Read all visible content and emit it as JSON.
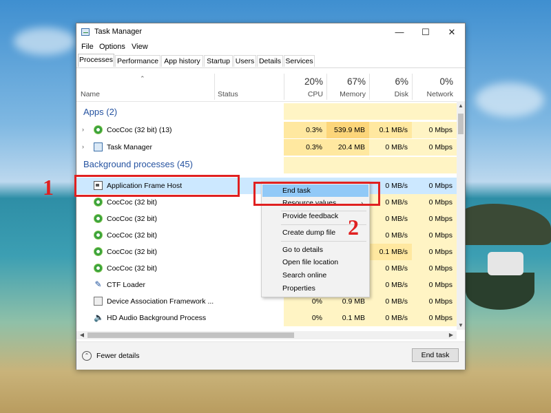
{
  "window": {
    "title": "Task Manager",
    "controls": {
      "minimize": "—",
      "maximize": "☐",
      "close": "✕"
    }
  },
  "menu": [
    "File",
    "Options",
    "View"
  ],
  "tabs": [
    "Processes",
    "Performance",
    "App history",
    "Startup",
    "Users",
    "Details",
    "Services"
  ],
  "columns": {
    "name": "Name",
    "status": "Status",
    "cpu": {
      "pct": "20%",
      "label": "CPU"
    },
    "memory": {
      "pct": "67%",
      "label": "Memory"
    },
    "disk": {
      "pct": "6%",
      "label": "Disk"
    },
    "network": {
      "pct": "0%",
      "label": "Network"
    }
  },
  "groups": {
    "apps": "Apps (2)",
    "background": "Background processes (45)"
  },
  "apps": [
    {
      "name": "CocCoc (32 bit) (13)",
      "icon": "coccoc-icon",
      "cpu": "0.3%",
      "memory": "539.9 MB",
      "disk": "0.1 MB/s",
      "network": "0 Mbps"
    },
    {
      "name": "Task Manager",
      "icon": "task-manager-icon",
      "cpu": "0.3%",
      "memory": "20.4 MB",
      "disk": "0 MB/s",
      "network": "0 Mbps"
    }
  ],
  "background": [
    {
      "name": "Application Frame Host",
      "icon": "app-frame-icon",
      "cpu": "",
      "memory": "",
      "disk": "0 MB/s",
      "network": "0 Mbps"
    },
    {
      "name": "CocCoc (32 bit)",
      "icon": "coccoc-icon",
      "cpu": "",
      "memory": "",
      "disk": "0 MB/s",
      "network": "0 Mbps"
    },
    {
      "name": "CocCoc (32 bit)",
      "icon": "coccoc-icon",
      "cpu": "",
      "memory": "",
      "disk": "0 MB/s",
      "network": "0 Mbps"
    },
    {
      "name": "CocCoc (32 bit)",
      "icon": "coccoc-icon",
      "cpu": "",
      "memory": "",
      "disk": "0 MB/s",
      "network": "0 Mbps"
    },
    {
      "name": "CocCoc (32 bit)",
      "icon": "coccoc-icon",
      "cpu": "",
      "memory": "",
      "disk": "0.1 MB/s",
      "network": "0 Mbps"
    },
    {
      "name": "CocCoc (32 bit)",
      "icon": "coccoc-icon",
      "cpu": "",
      "memory": "",
      "disk": "0 MB/s",
      "network": "0 Mbps"
    },
    {
      "name": "CTF Loader",
      "icon": "ctf-loader-icon",
      "cpu": "",
      "memory": "",
      "disk": "0 MB/s",
      "network": "0 Mbps"
    },
    {
      "name": "Device Association Framework ...",
      "icon": "device-icon",
      "cpu": "0%",
      "memory": "0.9 MB",
      "disk": "0 MB/s",
      "network": "0 Mbps"
    },
    {
      "name": "HD Audio Background Process",
      "icon": "audio-icon",
      "cpu": "0%",
      "memory": "0.1 MB",
      "disk": "0 MB/s",
      "network": "0 Mbps"
    }
  ],
  "context_menu": [
    {
      "label": "End task",
      "highlighted": true
    },
    {
      "label": "Resource values",
      "submenu": true
    },
    {
      "separator": true
    },
    {
      "label": "Provide feedback"
    },
    {
      "separator": true
    },
    {
      "label": "Create dump file"
    },
    {
      "separator": true
    },
    {
      "label": "Go to details"
    },
    {
      "label": "Open file location"
    },
    {
      "label": "Search online"
    },
    {
      "label": "Properties"
    }
  ],
  "footer": {
    "fewer_details": "Fewer details",
    "end_task": "End task"
  },
  "annotations": {
    "one": "1",
    "two": "2"
  },
  "colors": {
    "annotation": "#e02020",
    "selection": "#cce8ff",
    "menu_highlight": "#91c9f7",
    "group_title": "#2452a0"
  }
}
